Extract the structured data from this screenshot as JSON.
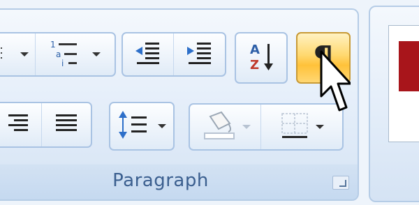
{
  "group": {
    "label": "Paragraph"
  },
  "icons": {
    "numbering": "numbering-icon",
    "multilevel_list": "multilevel-list-icon",
    "decrease_indent": "decrease-indent-icon",
    "increase_indent": "increase-indent-icon",
    "sort": "sort-az-icon",
    "show_hide": "pilcrow-icon",
    "align_right": "align-right-icon",
    "justify": "justify-icon",
    "line_spacing": "line-spacing-icon",
    "shading": "shading-bucket-icon",
    "borders": "borders-icon"
  },
  "sort_glyph": {
    "top": "A",
    "bottom": "Z"
  },
  "show_hide_glyph": "¶",
  "colors": {
    "active_button": "#ffc23a",
    "group_label": "#3b5f8f",
    "sort_red": "#c0392b",
    "style_red": "#a8151b"
  }
}
